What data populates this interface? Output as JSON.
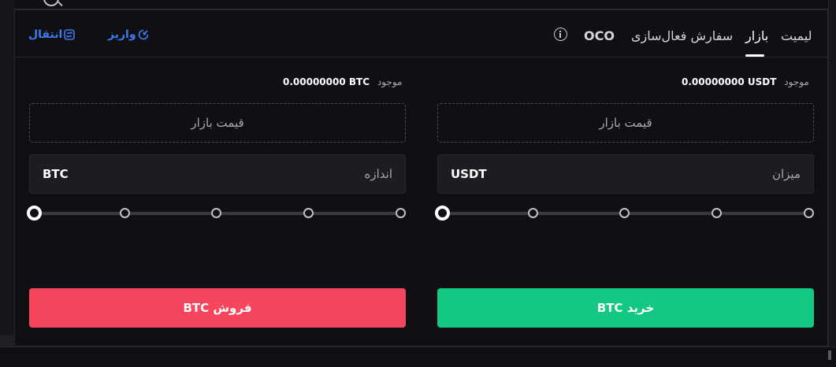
{
  "tabs": {
    "limit": "لیمیت",
    "market": "بازار",
    "trigger": "سفارش فعال‌سازی",
    "oco": "OCO"
  },
  "links": {
    "deposit": "واریز",
    "transfer": "انتقال"
  },
  "buy": {
    "balance_label": "موجود",
    "balance_value": "0.00000000 USDT",
    "price_placeholder": "قیمت بازار",
    "amount_label": "میزان",
    "amount_unit": "USDT",
    "slider_value_percent": 0,
    "button_label": "خرید BTC"
  },
  "sell": {
    "balance_label": "موجود",
    "balance_value": "0.00000000 BTC",
    "price_placeholder": "قیمت بازار",
    "amount_label": "اندازه",
    "amount_unit": "BTC",
    "slider_value_percent": 0,
    "button_label": "فروش BTC"
  },
  "colors": {
    "buy": "#12c882",
    "sell": "#f6465d",
    "link": "#3d7bf0",
    "background": "#101014"
  },
  "icons": {
    "info": "info-icon",
    "deposit": "deposit-icon",
    "transfer": "transfer-icon",
    "search": "search-icon"
  }
}
